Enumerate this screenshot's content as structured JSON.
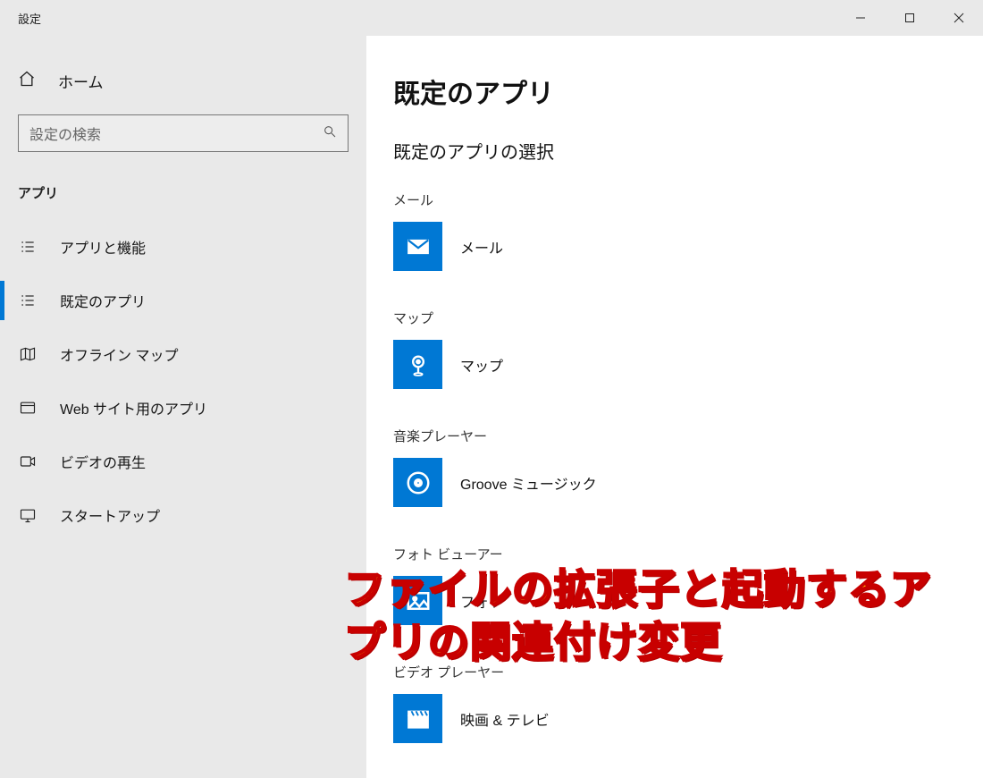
{
  "titlebar": {
    "title": "設定"
  },
  "sidebar": {
    "home_label": "ホーム",
    "search_placeholder": "設定の検索",
    "section_label": "アプリ",
    "items": [
      {
        "label": "アプリと機能",
        "selected": false
      },
      {
        "label": "既定のアプリ",
        "selected": true
      },
      {
        "label": "オフライン マップ",
        "selected": false
      },
      {
        "label": "Web サイト用のアプリ",
        "selected": false
      },
      {
        "label": "ビデオの再生",
        "selected": false
      },
      {
        "label": "スタートアップ",
        "selected": false
      }
    ]
  },
  "main": {
    "page_title": "既定のアプリ",
    "section_heading": "既定のアプリの選択",
    "categories": [
      {
        "label": "メール",
        "app_name": "メール",
        "icon": "mail"
      },
      {
        "label": "マップ",
        "app_name": "マップ",
        "icon": "map-pin"
      },
      {
        "label": "音楽プレーヤー",
        "app_name": "Groove ミュージック",
        "icon": "groove"
      },
      {
        "label": "フォト ビューアー",
        "app_name": "フォト",
        "icon": "photo"
      },
      {
        "label": "ビデオ プレーヤー",
        "app_name": "映画 & テレビ",
        "icon": "movie"
      }
    ]
  },
  "overlay": {
    "text": "ファイルの拡張子と起動するアプリの関連付け変更"
  },
  "colors": {
    "accent": "#0078d4"
  }
}
